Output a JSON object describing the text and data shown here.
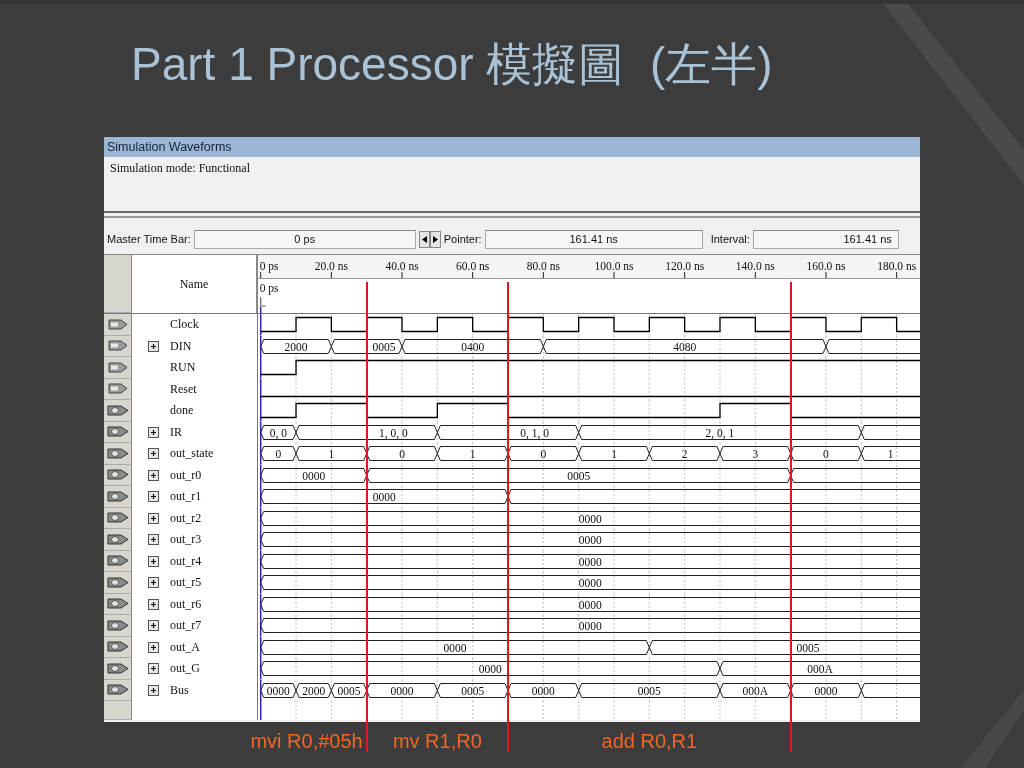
{
  "slide": {
    "title": "Part 1 Processor 模擬圖  (左半)"
  },
  "window": {
    "title": "Simulation Waveforms",
    "mode": "Simulation mode: Functional",
    "master_time_bar": {
      "label": "Master Time Bar:",
      "value": "0 ps"
    },
    "pointer": {
      "label": "Pointer:",
      "value": "161.41 ns"
    },
    "interval": {
      "label": "Interval:",
      "value": "161.41 ns"
    }
  },
  "waveforms": {
    "name_header": "Name",
    "ticks": [
      "0 ps",
      "20.0 ns",
      "40.0 ns",
      "60.0 ns",
      "80.0 ns",
      "100.0 ns",
      "120.0 ns",
      "140.0 ns",
      "160.0 ns",
      "180.0 ns"
    ],
    "cursor_label": "0 ps",
    "signals": [
      {
        "name": "Clock",
        "kind": "input",
        "expandable": false
      },
      {
        "name": "DIN",
        "kind": "input",
        "expandable": true,
        "values": [
          "2000",
          "0005",
          "0400",
          "4080"
        ]
      },
      {
        "name": "RUN",
        "kind": "input",
        "expandable": false
      },
      {
        "name": "Reset",
        "kind": "input",
        "expandable": false
      },
      {
        "name": "done",
        "kind": "output",
        "expandable": false
      },
      {
        "name": "IR",
        "kind": "output",
        "expandable": true,
        "values": [
          "0, 0",
          "1, 0, 0",
          "0, 1, 0",
          "2, 0, 1"
        ]
      },
      {
        "name": "out_state",
        "kind": "output",
        "expandable": true,
        "values": [
          "0",
          "1",
          "0",
          "1",
          "0",
          "1",
          "2",
          "3",
          "0",
          "1"
        ]
      },
      {
        "name": "out_r0",
        "kind": "output",
        "expandable": true,
        "values": [
          "0000",
          "0005"
        ]
      },
      {
        "name": "out_r1",
        "kind": "output",
        "expandable": true,
        "values": [
          "0000"
        ]
      },
      {
        "name": "out_r2",
        "kind": "output",
        "expandable": true,
        "values": [
          "0000"
        ]
      },
      {
        "name": "out_r3",
        "kind": "output",
        "expandable": true,
        "values": [
          "0000"
        ]
      },
      {
        "name": "out_r4",
        "kind": "output",
        "expandable": true,
        "values": [
          "0000"
        ]
      },
      {
        "name": "out_r5",
        "kind": "output",
        "expandable": true,
        "values": [
          "0000"
        ]
      },
      {
        "name": "out_r6",
        "kind": "output",
        "expandable": true,
        "values": [
          "0000"
        ]
      },
      {
        "name": "out_r7",
        "kind": "output",
        "expandable": true,
        "values": [
          "0000"
        ]
      },
      {
        "name": "out_A",
        "kind": "output",
        "expandable": true,
        "values": [
          "0000",
          "0005"
        ]
      },
      {
        "name": "out_G",
        "kind": "output",
        "expandable": true,
        "values": [
          "0000",
          "000A"
        ]
      },
      {
        "name": "Bus",
        "kind": "output",
        "expandable": true,
        "values": [
          "0000",
          "2000",
          "0005",
          "0000",
          "0005",
          "0000",
          "0005",
          "000A",
          "0000"
        ]
      }
    ]
  },
  "annotations": [
    {
      "label": "mvi R0,#05h"
    },
    {
      "label": "mv R1,R0"
    },
    {
      "label": "add R0,R1"
    }
  ]
}
